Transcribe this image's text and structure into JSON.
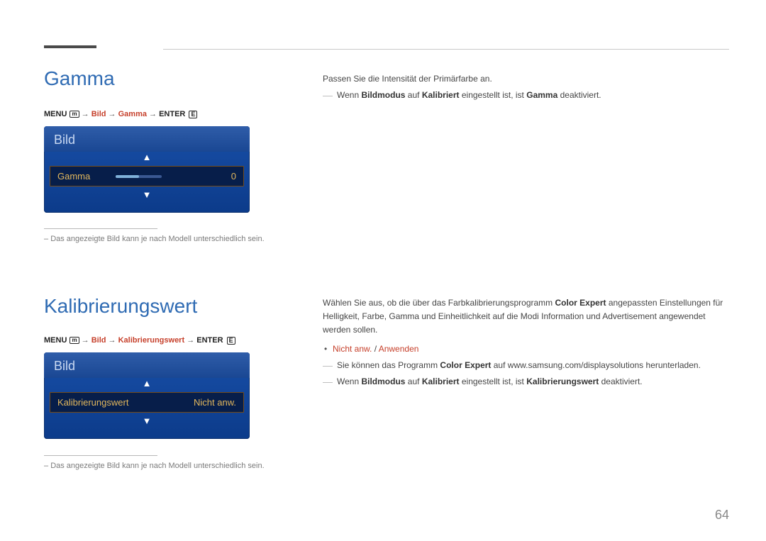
{
  "page_number": "64",
  "section1": {
    "title": "Gamma",
    "breadcrumb": {
      "menu": "MENU",
      "bild": "Bild",
      "item": "Gamma",
      "enter": "ENTER"
    },
    "panel": {
      "header": "Bild",
      "row_label": "Gamma",
      "row_value": "0"
    },
    "footnote": "Das angezeigte Bild kann je nach Modell unterschiedlich sein.",
    "right": {
      "intro": "Passen Sie die Intensität der Primärfarbe an.",
      "note_pre": "Wenn ",
      "note_bold1": "Bildmodus",
      "note_mid1": " auf ",
      "note_bold2": "Kalibriert",
      "note_mid2": " eingestellt ist, ist ",
      "note_bold3": "Gamma",
      "note_end": " deaktiviert."
    }
  },
  "section2": {
    "title": "Kalibrierungswert",
    "breadcrumb": {
      "menu": "MENU",
      "bild": "Bild",
      "item": "Kalibrierungswert",
      "enter": "ENTER"
    },
    "panel": {
      "header": "Bild",
      "row_label": "Kalibrierungswert",
      "row_value": "Nicht anw."
    },
    "footnote": "Das angezeigte Bild kann je nach Modell unterschiedlich sein.",
    "right": {
      "intro_pre": "Wählen Sie aus, ob die über das Farbkalibrierungsprogramm ",
      "intro_bold": "Color Expert",
      "intro_post": " angepassten Einstellungen für Helligkeit, Farbe, Gamma und Einheitlichkeit auf die Modi Information und Advertisement angewendet werden sollen.",
      "bullet_opt1": "Nicht anw.",
      "bullet_sep": " / ",
      "bullet_opt2": "Anwenden",
      "note1_pre": "Sie können das Programm ",
      "note1_bold": "Color Expert",
      "note1_post": " auf www.samsung.com/displaysolutions herunterladen.",
      "note2_pre": "Wenn ",
      "note2_bold1": "Bildmodus",
      "note2_mid1": " auf ",
      "note2_bold2": "Kalibriert",
      "note2_mid2": " eingestellt ist, ist ",
      "note2_bold3": "Kalibrierungswert",
      "note2_end": " deaktiviert."
    }
  }
}
